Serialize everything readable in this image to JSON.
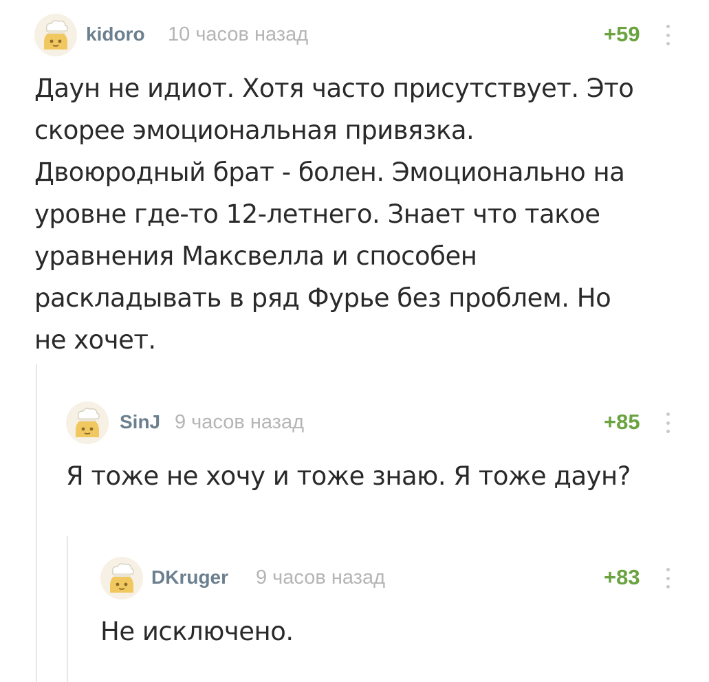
{
  "comments": [
    {
      "username": "kidoro",
      "time": "10 часов назад",
      "rating": "+59",
      "text": "Даун не идиот. Хотя часто присутствует. Это\nскорее эмоциональная привязка.\nДвоюродный брат - болен. Эмоционально на\nуровне где-то 12-летнего. Знает что такое\nуравнения Максвелла и способен\nраскладывать в ряд Фурье без проблем. Но\nне хочет.",
      "avatar_icon": "default-avatar-icon",
      "more_icon": "vertical-dots-icon"
    },
    {
      "username": "SinJ",
      "time": "9 часов назад",
      "rating": "+85",
      "text": "Я тоже не хочу и тоже знаю. Я тоже даун?",
      "avatar_icon": "default-avatar-icon",
      "more_icon": "vertical-dots-icon"
    },
    {
      "username": "DKruger",
      "time": "9 часов назад",
      "rating": "+83",
      "text": "Не исключено.",
      "avatar_icon": "default-avatar-icon",
      "more_icon": "vertical-dots-icon"
    }
  ],
  "colors": {
    "username": "#6b7f8e",
    "time": "#b5b5b5",
    "rating": "#6aa33f",
    "text": "#2a2a2a",
    "thread_line": "#e6e6e6"
  }
}
